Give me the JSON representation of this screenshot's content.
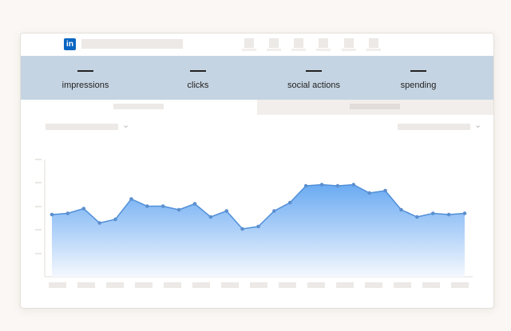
{
  "header": {
    "logo_text": "in",
    "logo_color": "#0a66c2"
  },
  "metrics": [
    {
      "value": "—",
      "label": "impressions"
    },
    {
      "value": "—",
      "label": "clicks"
    },
    {
      "value": "—",
      "label": "social actions"
    },
    {
      "value": "—",
      "label": "spending"
    }
  ],
  "colors": {
    "metrics_band": "#c5d4e2",
    "area_top": "#6aaaf2",
    "area_bottom": "#f4f8fe",
    "line": "#4f8fd8",
    "point": "#5b8fd0"
  },
  "chart_data": {
    "type": "area",
    "title": "",
    "xlabel": "",
    "ylabel": "",
    "grid": false,
    "series": [
      {
        "values": [
          0.52,
          0.53,
          0.57,
          0.45,
          0.48,
          0.65,
          0.59,
          0.59,
          0.56,
          0.61,
          0.5,
          0.55,
          0.4,
          0.42,
          0.55,
          0.62,
          0.76,
          0.77,
          0.76,
          0.77,
          0.7,
          0.72,
          0.56,
          0.5,
          0.53,
          0.52,
          0.53
        ]
      }
    ]
  }
}
